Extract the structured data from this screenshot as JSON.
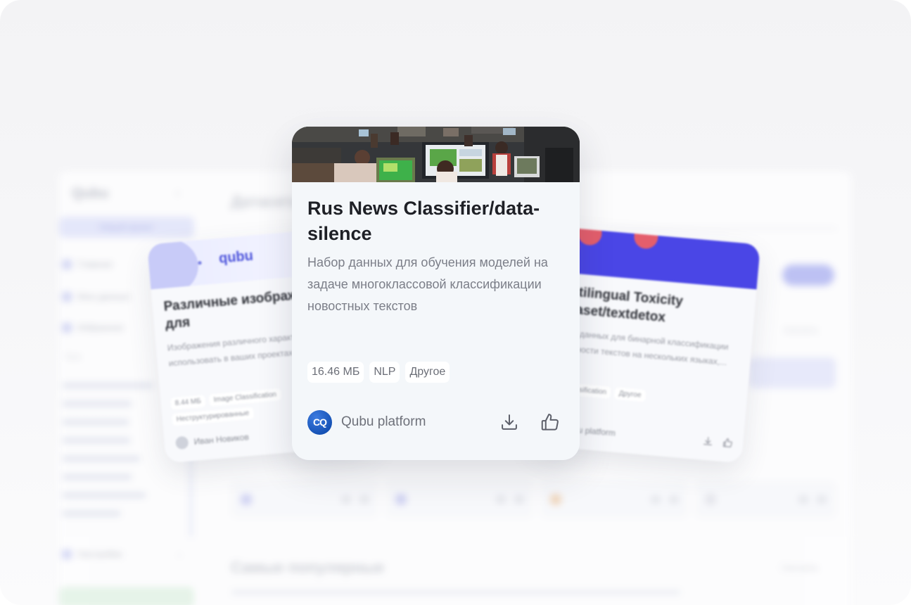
{
  "main_card": {
    "title": "Rus News Classifier/data-silence",
    "description": "Набор данных для обучения моделей на задаче многоклассовой классификации новостных текстов",
    "tags": [
      "16.46 МБ",
      "NLP",
      "Другое"
    ],
    "author": "Qubu platform",
    "avatar_initials": "CQ",
    "icons": {
      "download": "download-icon",
      "like": "thumbs-up-icon"
    }
  },
  "left_card": {
    "brand": "qubu",
    "title": "Различные изображения для",
    "description": "Изображения различного характера, чтобы использовать в ваших проектах.",
    "tags": [
      "8.44 МБ",
      "Image Classification",
      "Неструктурированные"
    ],
    "author": "Иван Новиков"
  },
  "right_card": {
    "title": "Multilingual Toxicity Dataset/textdetox",
    "description": "Набор данных для бинарной классификации токсичности текстов на нескольких языках,...",
    "tags": [
      "Text Classification",
      "Другое"
    ],
    "author": "Qubu platform"
  },
  "background": {
    "logo": "Qubu",
    "new_button": "Новый проект",
    "nav": [
      "Главная",
      "Мои данные",
      "Избранное"
    ],
    "section_label": "Теги",
    "notifications": "Настройки",
    "heading": "Датасеты",
    "popular_heading": "Самые популярные",
    "see_all": "Смотреть"
  },
  "colors": {
    "accent": "#4b52db",
    "avatar": "#1a5fc4",
    "title": "#1e2026",
    "muted": "#7b7e88"
  }
}
